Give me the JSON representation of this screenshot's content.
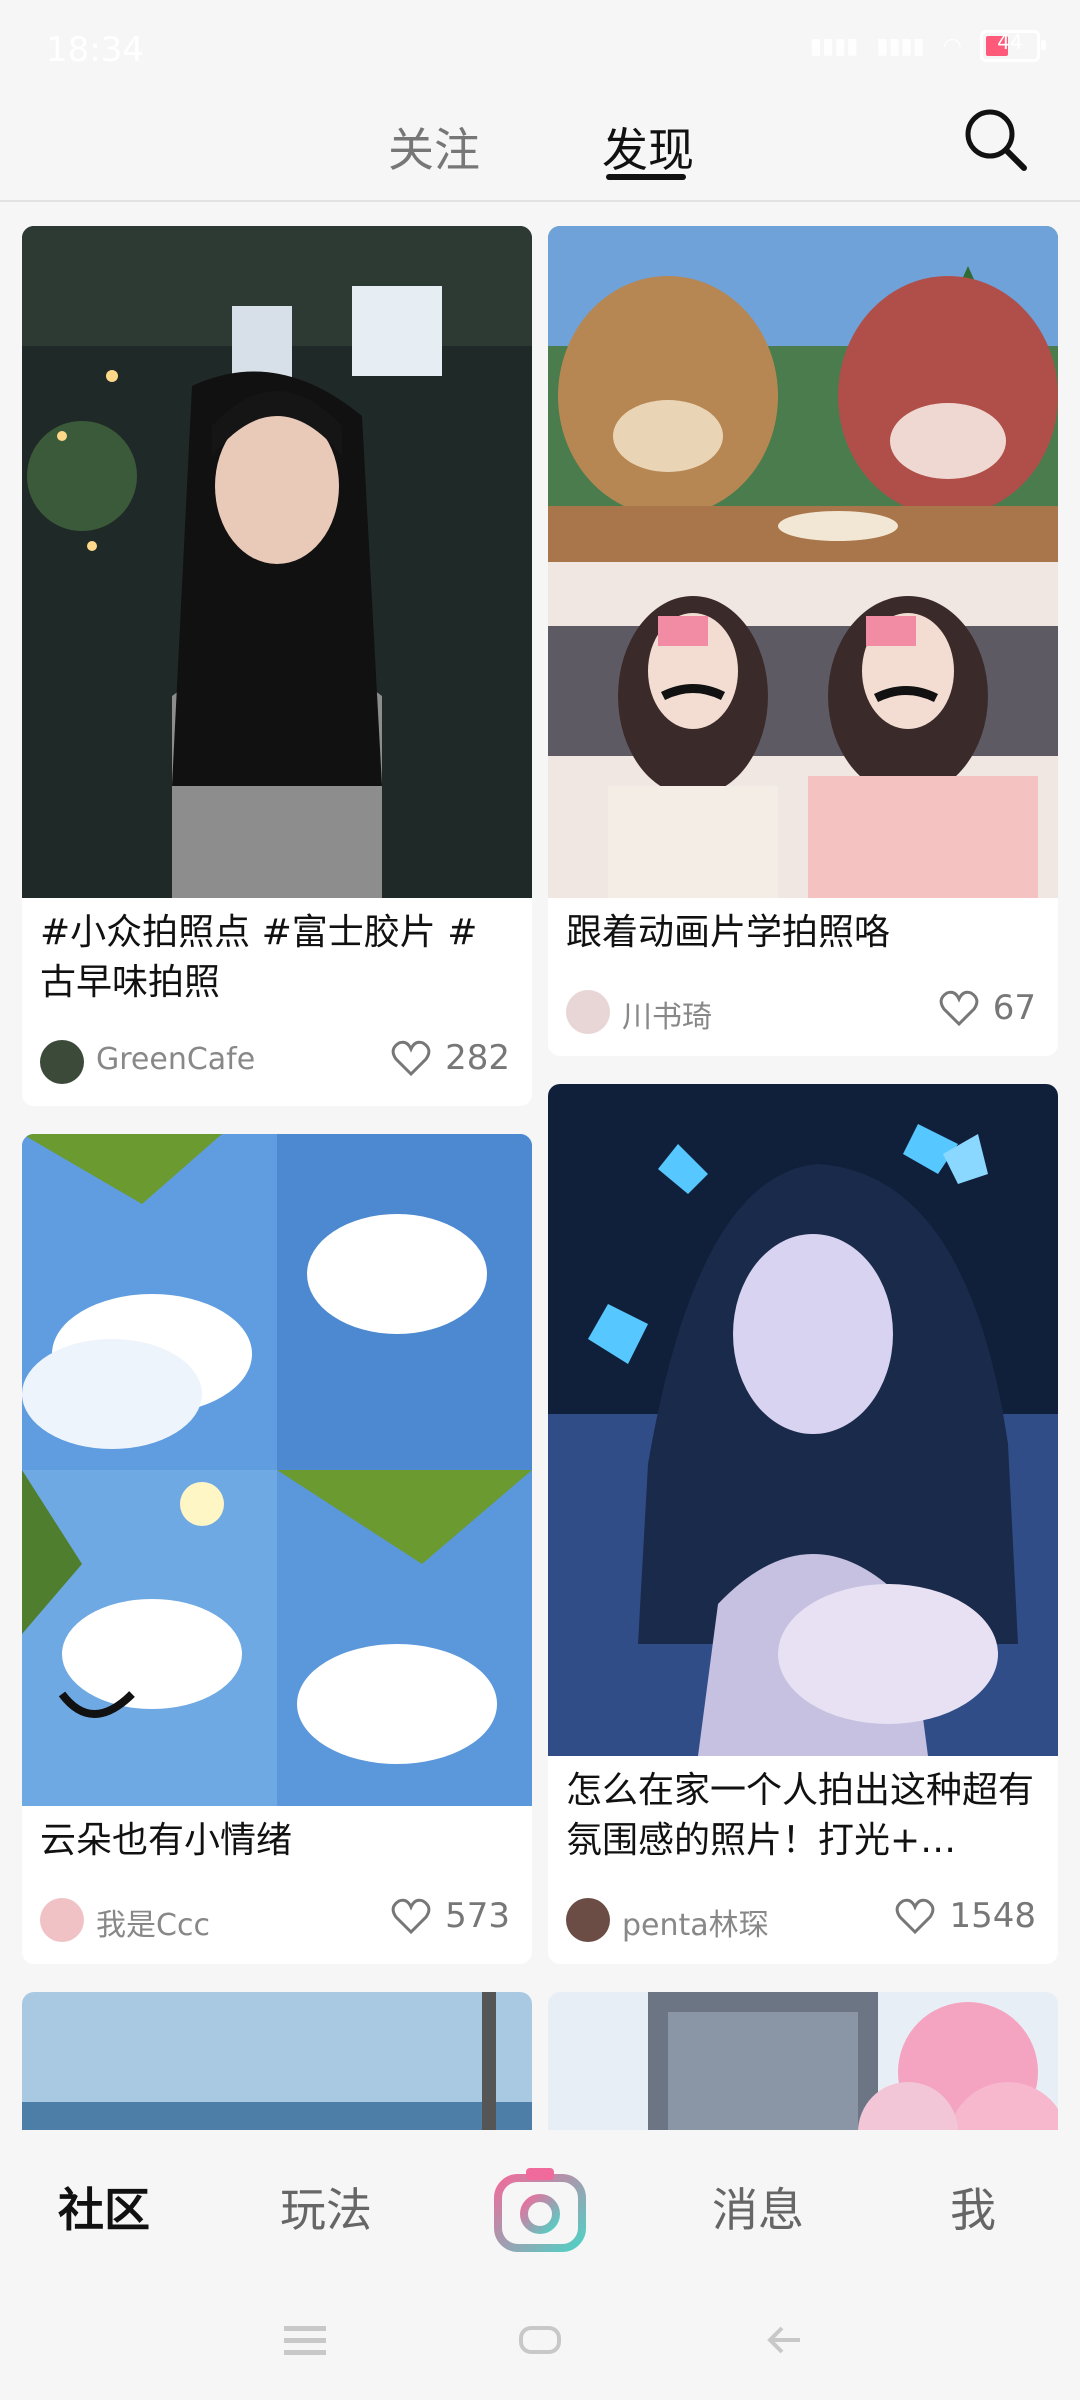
{
  "status_bar": {
    "time": "18:34",
    "signal_text": "...",
    "battery_level": "44"
  },
  "tabs": [
    {
      "label": "关注"
    },
    {
      "label": "发现"
    }
  ],
  "posts": [
    {
      "title": "#小众拍照点 #富士胶片 #古早味拍照",
      "author": "GreenCafe",
      "likes": "282"
    },
    {
      "title": "跟着动画片学拍照咯",
      "author": "川书琦",
      "likes": "67"
    },
    {
      "title": "云朵也有小情绪",
      "author": "我是Ccc",
      "likes": "573"
    },
    {
      "title": "怎么在家一个人拍出这种超有氛围感的照片！打光+…",
      "author": "penta林琛",
      "likes": "1548"
    }
  ],
  "bottom_nav": [
    {
      "label": "社区"
    },
    {
      "label": "玩法"
    },
    {
      "label": "消息"
    },
    {
      "label": "我"
    }
  ],
  "colors": {
    "accent_pink": "#f06b9b",
    "accent_teal": "#4fd1c5",
    "text_primary": "#111111"
  },
  "icons": {
    "search": "search-icon",
    "heart": "heart-icon",
    "camera": "camera-icon"
  }
}
